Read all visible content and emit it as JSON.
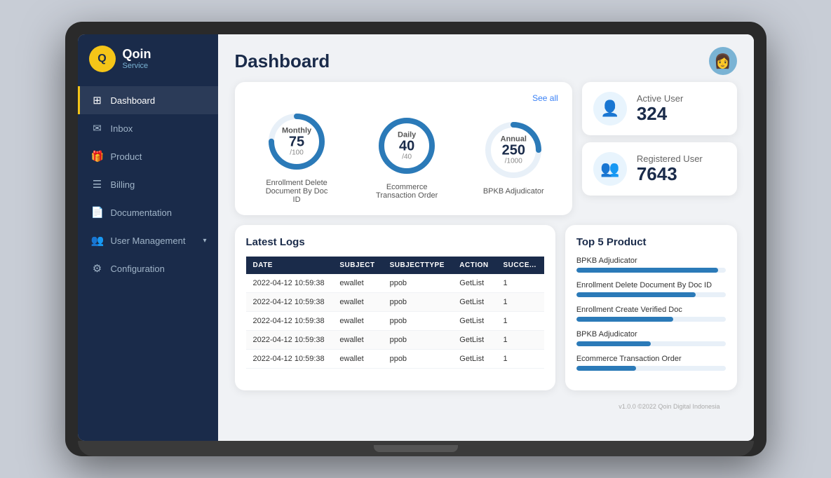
{
  "app": {
    "name": "Qoin",
    "sub": "Service",
    "title": "Dashboard",
    "footer": "v1.0.0 ©2022 Qoin Digital Indonesia"
  },
  "sidebar": {
    "items": [
      {
        "id": "dashboard",
        "label": "Dashboard",
        "icon": "⊞",
        "active": true
      },
      {
        "id": "inbox",
        "label": "Inbox",
        "icon": "✉",
        "active": false
      },
      {
        "id": "product",
        "label": "Product",
        "icon": "🎁",
        "active": false
      },
      {
        "id": "billing",
        "label": "Billing",
        "icon": "☰",
        "active": false
      },
      {
        "id": "documentation",
        "label": "Documentation",
        "icon": "📄",
        "active": false
      },
      {
        "id": "user-management",
        "label": "User Management",
        "icon": "👥",
        "active": false,
        "hasChevron": true
      },
      {
        "id": "configuration",
        "label": "Configuration",
        "icon": "⚙",
        "active": false
      }
    ]
  },
  "header": {
    "title": "Dashboard",
    "see_all": "See all"
  },
  "stats": {
    "cards": [
      {
        "period": "Monthly",
        "value": "75",
        "max": "/100",
        "percent": 75,
        "label": "Enrollment Delete Document By Doc ID"
      },
      {
        "period": "Daily",
        "value": "40",
        "max": "/40",
        "percent": 100,
        "label": "Ecommerce Transaction Order"
      },
      {
        "period": "Annual",
        "value": "250",
        "max": "/1000",
        "percent": 25,
        "label": "BPKB Adjudicator"
      }
    ]
  },
  "user_cards": [
    {
      "id": "active-user",
      "title": "Active User",
      "value": "324"
    },
    {
      "id": "registered-user",
      "title": "Registered User",
      "value": "7643"
    }
  ],
  "logs": {
    "title": "Latest Logs",
    "columns": [
      "DATE",
      "SUBJECT",
      "SUBJECTTYPE",
      "ACTION",
      "SUCCE..."
    ],
    "rows": [
      {
        "date": "2022-04-12 10:59:38",
        "subject": "ewallet",
        "subjecttype": "ppob",
        "action": "GetList",
        "success": "1"
      },
      {
        "date": "2022-04-12 10:59:38",
        "subject": "ewallet",
        "subjecttype": "ppob",
        "action": "GetList",
        "success": "1"
      },
      {
        "date": "2022-04-12 10:59:38",
        "subject": "ewallet",
        "subjecttype": "ppob",
        "action": "GetList",
        "success": "1"
      },
      {
        "date": "2022-04-12 10:59:38",
        "subject": "ewallet",
        "subjecttype": "ppob",
        "action": "GetList",
        "success": "1"
      },
      {
        "date": "2022-04-12 10:59:38",
        "subject": "ewallet",
        "subjecttype": "ppob",
        "action": "GetList",
        "success": "1"
      }
    ]
  },
  "top5": {
    "title": "Top 5 Product",
    "items": [
      {
        "name": "BPKB Adjudicator",
        "percent": 95
      },
      {
        "name": "Enrollment Delete Document By Doc ID",
        "percent": 80
      },
      {
        "name": "Enrollment Create Verified Doc",
        "percent": 65
      },
      {
        "name": "BPKB Adjudicator",
        "percent": 50
      },
      {
        "name": "Ecommerce Transaction Order",
        "percent": 40
      }
    ]
  },
  "colors": {
    "sidebar_bg": "#1a2b4a",
    "accent": "#f5c518",
    "primary": "#2b7ab8",
    "active_nav_border": "#f5c518"
  }
}
